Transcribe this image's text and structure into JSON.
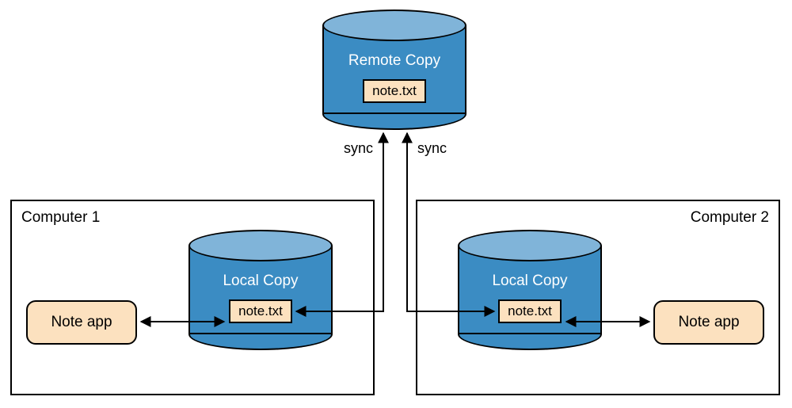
{
  "remote": {
    "title": "Remote Copy",
    "file": "note.txt"
  },
  "computers": [
    {
      "label": "Computer 1",
      "app": "Note app",
      "local": {
        "title": "Local Copy",
        "file": "note.txt"
      },
      "sync_label": "sync"
    },
    {
      "label": "Computer 2",
      "app": "Note app",
      "local": {
        "title": "Local Copy",
        "file": "note.txt"
      },
      "sync_label": "sync"
    }
  ],
  "colors": {
    "db_side": "#3b8cc3",
    "db_top": "#80b4d9",
    "badge": "#fce1bf",
    "stroke": "#000000"
  }
}
